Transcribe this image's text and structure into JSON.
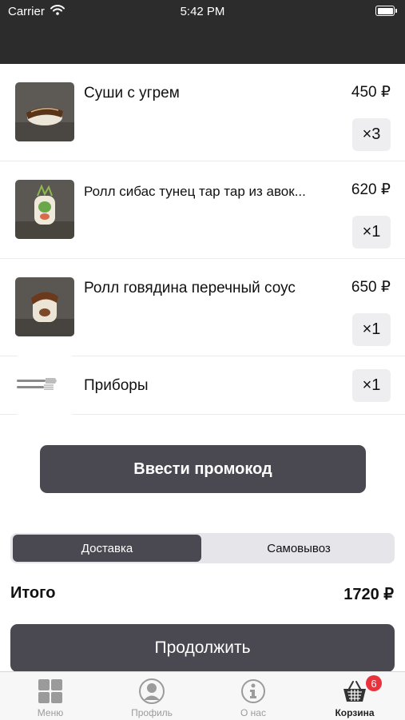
{
  "status_bar": {
    "carrier": "Carrier",
    "time": "5:42 PM"
  },
  "cart": {
    "items": [
      {
        "name": "Суши с угрем",
        "price": "450 ₽",
        "qty": "×3"
      },
      {
        "name": "Ролл сибас тунец тар тар из авок...",
        "price": "620 ₽",
        "qty": "×1"
      },
      {
        "name": "Ролл говядина перечный соус",
        "price": "650 ₽",
        "qty": "×1"
      },
      {
        "name": "Приборы",
        "qty": "×1"
      }
    ]
  },
  "promo_button": "Ввести промокод",
  "delivery_toggle": {
    "options": [
      "Доставка",
      "Самовывоз"
    ],
    "selected": "Доставка"
  },
  "total": {
    "label": "Итого",
    "value": "1720 ₽"
  },
  "continue_button": "Продолжить",
  "tab_bar": {
    "tabs": [
      {
        "label": "Меню",
        "icon": "grid-icon"
      },
      {
        "label": "Профиль",
        "icon": "profile-icon"
      },
      {
        "label": "О нас",
        "icon": "info-icon"
      },
      {
        "label": "Корзина",
        "icon": "basket-icon",
        "badge": "6",
        "active": true
      }
    ]
  },
  "colors": {
    "header": "#2c2c2c",
    "button": "#4a4850",
    "badge": "#e8323c",
    "qty_bg": "#eeeef1"
  }
}
